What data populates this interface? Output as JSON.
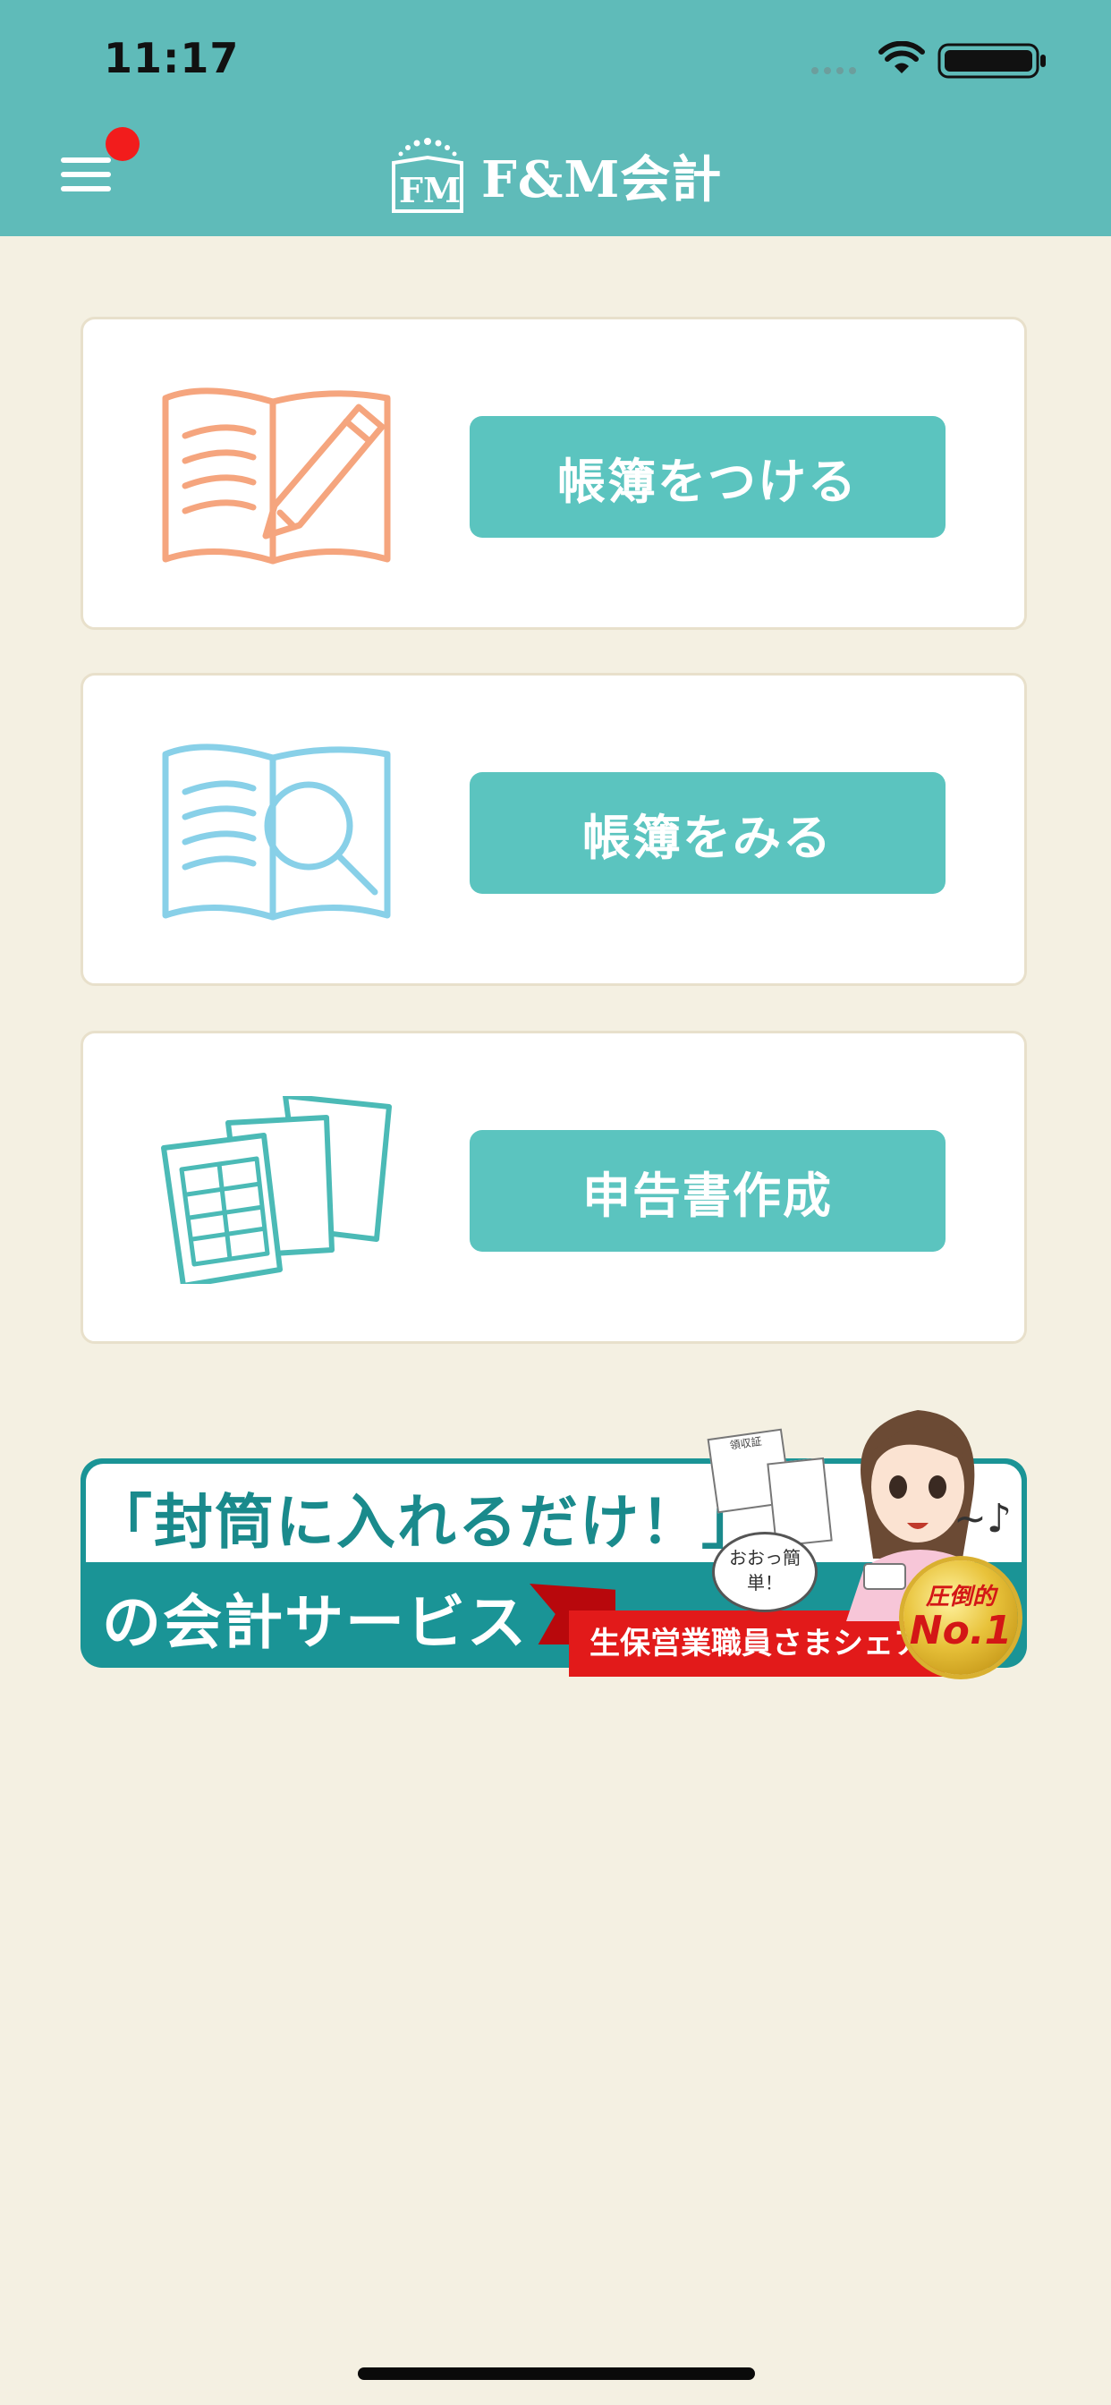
{
  "status_bar": {
    "time": "11:17"
  },
  "header": {
    "logo_text": "F&M会計",
    "logo_mark": "FM"
  },
  "cards": [
    {
      "button_label": "帳簿をつける",
      "icon": "notebook-pencil-icon",
      "icon_color": "#F5A57E"
    },
    {
      "button_label": "帳簿をみる",
      "icon": "notebook-magnifier-icon",
      "icon_color": "#88D0E8"
    },
    {
      "button_label": "申告書作成",
      "icon": "tax-forms-icon",
      "icon_color": "#4BBAB6"
    }
  ],
  "banner": {
    "headline": "「封筒に入れるだけ！」",
    "subline": "の会計サービス",
    "ribbon": "生保営業職員さまシェア",
    "bubble": "おおっ簡単！",
    "receipt": "領収証",
    "medal_top": "圧倒的",
    "medal_bottom": "No.1"
  },
  "colors": {
    "header": "#5FBBB9",
    "background": "#F4F0E2",
    "button": "#5BC4BF",
    "notification_dot": "#F21C1C"
  }
}
